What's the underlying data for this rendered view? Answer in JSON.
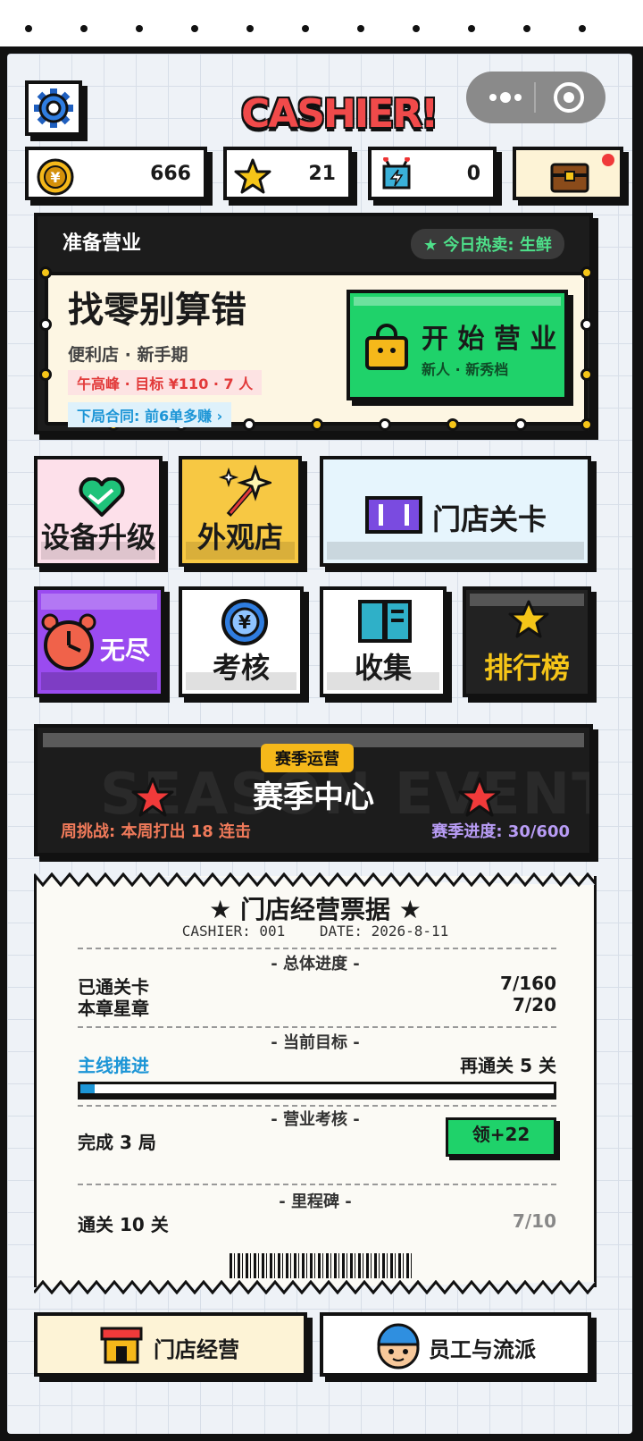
{
  "header": {
    "logo_text": "CASHIER!"
  },
  "stats": {
    "coins": "666",
    "stars": "21",
    "tickets": "0"
  },
  "banner": {
    "status": "准备营业",
    "hot_sale": "★ 今日热卖: 生鲜",
    "title": "找零别算错",
    "store_tier": "便利店 · 新手期",
    "rush": "午高峰 · 目标 ¥110 · 7 人",
    "contract": "下局合同: 前6单多赚 ›",
    "start_label": "开 始 营 业",
    "start_sub": "新人 · 新秀档"
  },
  "tiles": {
    "upgrade": "设备升级",
    "shop": "外观店",
    "levels": "门店关卡",
    "endless": "无尽",
    "exam": "考核",
    "collect": "收集",
    "ranking": "排行榜"
  },
  "season": {
    "badge": "赛季运营",
    "title": "赛季中心",
    "watermark": "SEASON EVENT",
    "weekly": "周挑战: 本周打出 18 连击",
    "progress": "赛季进度: 30/600"
  },
  "receipt": {
    "title": "★ 门店经营票据 ★",
    "meta": "CASHIER: 001    DATE: 2026-8-11",
    "sec_overall": "- 总体进度 -",
    "cleared_label": "已通关卡",
    "cleared_value": "7/160",
    "stars_label": "本章星章",
    "stars_value": "7/20",
    "sec_goal": "- 当前目标 -",
    "goal_label": "主线推进",
    "goal_value": "再通关 5 关",
    "goal_progress": 0.03,
    "sec_exam": "- 营业考核 -",
    "exam_label": "完成 3 局",
    "claim_label": "领+22",
    "sec_milestone": "- 里程碑 -",
    "milestone_label": "通关 10 关",
    "milestone_value": "7/10"
  },
  "bottom": {
    "store": "门店经营",
    "staff": "员工与流派"
  }
}
